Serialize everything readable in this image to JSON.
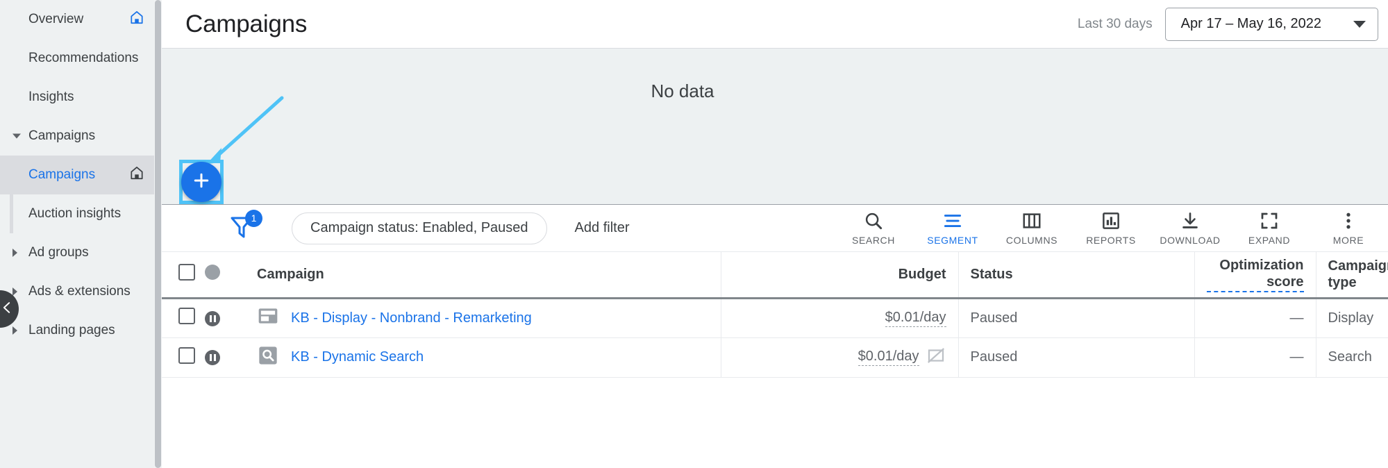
{
  "sidebar": {
    "items": [
      {
        "label": "Overview",
        "icon": "home-icon-blue",
        "state": "normal",
        "caret": "none"
      },
      {
        "label": "Recommendations",
        "icon": "none",
        "state": "normal",
        "caret": "none"
      },
      {
        "label": "Insights",
        "icon": "none",
        "state": "normal",
        "caret": "none"
      },
      {
        "label": "Campaigns",
        "icon": "none",
        "state": "group",
        "caret": "down"
      },
      {
        "label": "Campaigns",
        "icon": "home-icon-dark",
        "state": "selected",
        "caret": "none"
      },
      {
        "label": "Auction insights",
        "icon": "none",
        "state": "sub",
        "caret": "none"
      },
      {
        "label": "Ad groups",
        "icon": "none",
        "state": "group",
        "caret": "right"
      },
      {
        "label": "Ads & extensions",
        "icon": "none",
        "state": "group",
        "caret": "right"
      },
      {
        "label": "Landing pages",
        "icon": "none",
        "state": "group",
        "caret": "right"
      }
    ],
    "collapse_icon": "chevron-left-icon"
  },
  "header": {
    "title": "Campaigns",
    "range_label": "Last 30 days",
    "date_value": "Apr 17 – May 16, 2022",
    "dropdown_icon": "chevron-down-icon"
  },
  "chart": {
    "empty_message": "No data"
  },
  "toolbar": {
    "new_campaign_icon": "plus-icon",
    "filter_icon": "filter-icon",
    "filter_count": "1",
    "chip_label": "Campaign status: Enabled, Paused",
    "add_filter_label": "Add filter",
    "actions": [
      {
        "label": "SEARCH",
        "icon": "search-icon",
        "active": false
      },
      {
        "label": "SEGMENT",
        "icon": "segment-icon",
        "active": true
      },
      {
        "label": "COLUMNS",
        "icon": "columns-icon",
        "active": false
      },
      {
        "label": "REPORTS",
        "icon": "reports-icon",
        "active": false
      },
      {
        "label": "DOWNLOAD",
        "icon": "download-icon",
        "active": false
      },
      {
        "label": "EXPAND",
        "icon": "expand-icon",
        "active": false
      },
      {
        "label": "MORE",
        "icon": "more-vert-icon",
        "active": false
      }
    ]
  },
  "table": {
    "columns": [
      {
        "key": "check",
        "label": ""
      },
      {
        "key": "state",
        "label": ""
      },
      {
        "key": "name",
        "label": "Campaign"
      },
      {
        "key": "budget",
        "label": "Budget"
      },
      {
        "key": "status",
        "label": "Status"
      },
      {
        "key": "opt",
        "label": "Optimization score"
      },
      {
        "key": "type",
        "label": "Campaign type"
      }
    ],
    "rows": [
      {
        "checked": false,
        "state_icon": "paused-icon",
        "type_icon": "display-icon",
        "name": "KB - Display - Nonbrand - Remarketing",
        "budget": "$0.01/day",
        "budget_warning": false,
        "status": "Paused",
        "optimization_score": "—",
        "campaign_type": "Display"
      },
      {
        "checked": false,
        "state_icon": "paused-icon",
        "type_icon": "search-box-icon",
        "name": "KB - Dynamic Search",
        "budget": "$0.01/day",
        "budget_warning": true,
        "status": "Paused",
        "optimization_score": "—",
        "campaign_type": "Search"
      }
    ]
  },
  "annotation": {
    "arrow_color": "#4fc3f7",
    "highlight_color": "#4fc3f7",
    "target": "new-campaign-button"
  },
  "colors": {
    "accent_blue": "#1a73e8",
    "selected_blue": "#1967d2",
    "sidebar_bg": "#eef1f2",
    "chart_bg": "#edf1f2",
    "text_primary": "#202124",
    "text_secondary": "#5f6368"
  }
}
